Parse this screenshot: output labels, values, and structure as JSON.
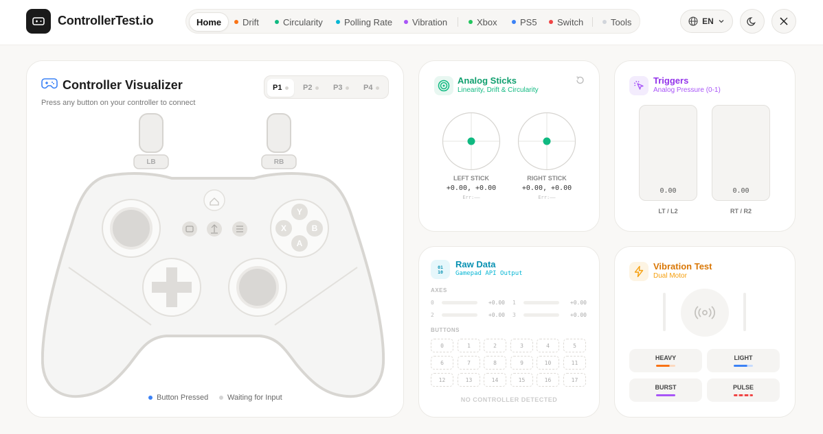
{
  "app": {
    "title": "ControllerTest.io"
  },
  "nav": {
    "items": [
      {
        "label": "Home",
        "color": ""
      },
      {
        "label": "Drift",
        "color": "#f97316"
      },
      {
        "label": "Circularity",
        "color": "#10b981"
      },
      {
        "label": "Polling Rate",
        "color": "#06b6d4"
      },
      {
        "label": "Vibration",
        "color": "#a855f7"
      },
      {
        "label": "Xbox",
        "color": "#22c55e"
      },
      {
        "label": "PS5",
        "color": "#3b82f6"
      },
      {
        "label": "Switch",
        "color": "#ef4444"
      },
      {
        "label": "Tools",
        "color": "#d1d5db"
      }
    ]
  },
  "header": {
    "language": "EN",
    "theme_icon": "moon-icon",
    "social_icon": "x-logo-icon"
  },
  "visualizer": {
    "title": "Controller Visualizer",
    "subtitle": "Press any button on your controller to connect",
    "players": [
      "P1",
      "P2",
      "P3",
      "P4"
    ],
    "active_player": "P1",
    "bumpers": {
      "left": "LB",
      "right": "RB"
    },
    "face_buttons": {
      "top": "Y",
      "left": "X",
      "right": "B",
      "bottom": "A"
    },
    "legend": {
      "pressed": "Button Pressed",
      "waiting": "Waiting for Input"
    },
    "colors": {
      "pressed": "#3b82f6",
      "waiting": "#d4d4d4"
    }
  },
  "analog": {
    "title": "Analog Sticks",
    "subtitle": "Linearity, Drift & Circularity",
    "accent": "#10b981",
    "left": {
      "label": "LEFT STICK",
      "value": "+0.00, +0.00",
      "err": "Err:——",
      "x": 0.0,
      "y": 0.0
    },
    "right": {
      "label": "RIGHT STICK",
      "value": "+0.00, +0.00",
      "err": "Err:——",
      "x": 0.0,
      "y": 0.0
    }
  },
  "triggers": {
    "title": "Triggers",
    "subtitle": "Analog Pressure (0-1)",
    "accent": "#a855f7",
    "lt": {
      "label": "LT / L2",
      "value": "0.00"
    },
    "rt": {
      "label": "RT / R2",
      "value": "0.00"
    }
  },
  "raw": {
    "title": "Raw Data",
    "subtitle": "Gamepad API Output",
    "accent": "#06b6d4",
    "axes_label": "AXES",
    "axes": [
      {
        "index": "0",
        "value": "+0.00"
      },
      {
        "index": "1",
        "value": "+0.00"
      },
      {
        "index": "2",
        "value": "+0.00"
      },
      {
        "index": "3",
        "value": "+0.00"
      }
    ],
    "buttons_label": "BUTTONS",
    "buttons": [
      "0",
      "1",
      "2",
      "3",
      "4",
      "5",
      "6",
      "7",
      "8",
      "9",
      "10",
      "11",
      "12",
      "13",
      "14",
      "15",
      "16",
      "17"
    ],
    "status": "NO CONTROLLER DETECTED"
  },
  "vibration": {
    "title": "Vibration Test",
    "subtitle": "Dual Motor",
    "accent": "#f59e0b",
    "modes": [
      {
        "label": "HEAVY",
        "color": "#f97316"
      },
      {
        "label": "LIGHT",
        "color": "#3b82f6"
      },
      {
        "label": "BURST",
        "color": "#a855f7"
      },
      {
        "label": "PULSE",
        "color": "#ef4444"
      }
    ]
  }
}
